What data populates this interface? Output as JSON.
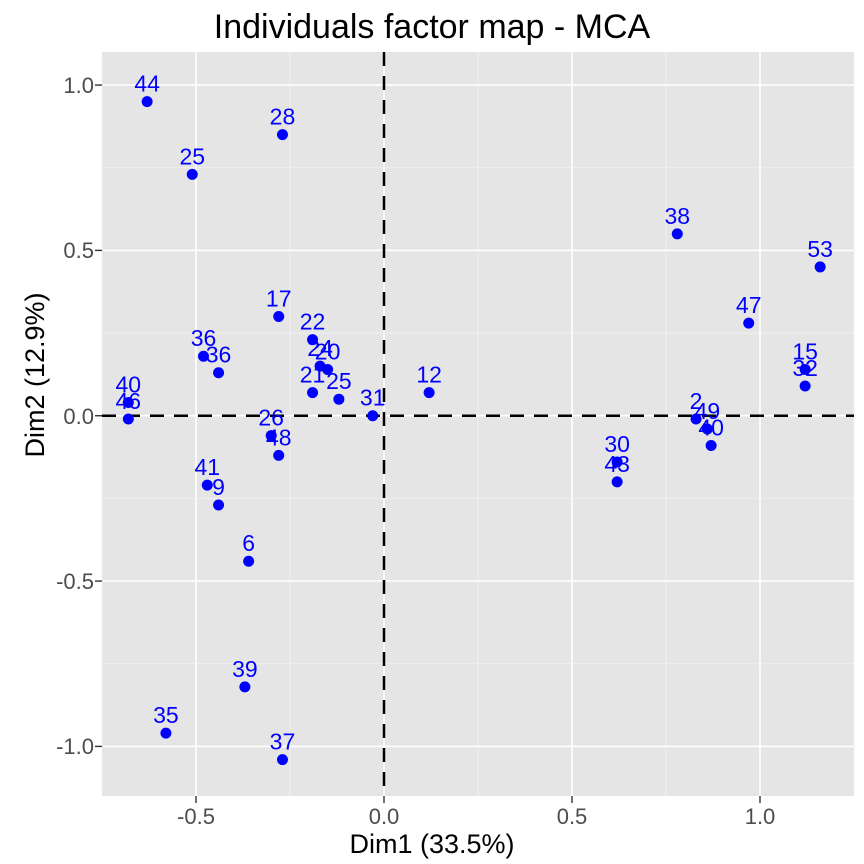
{
  "chart_data": {
    "type": "scatter",
    "title": "Individuals factor map - MCA",
    "xlabel": "Dim1 (33.5%)",
    "ylabel": "Dim2 (12.9%)",
    "xlim": [
      -0.75,
      1.25
    ],
    "ylim": [
      -1.15,
      1.1
    ],
    "x_ticks": [
      -0.5,
      0.0,
      0.5,
      1.0
    ],
    "y_ticks": [
      -1.0,
      -0.5,
      0.0,
      0.5,
      1.0
    ],
    "hline": 0.0,
    "vline": 0.0,
    "point_color": "#0000ff",
    "label_color": "#0000ff",
    "points": [
      {
        "label": "44",
        "x": -0.63,
        "y": 0.95
      },
      {
        "label": "25",
        "x": -0.51,
        "y": 0.73
      },
      {
        "label": "28",
        "x": -0.27,
        "y": 0.85
      },
      {
        "label": "17",
        "x": -0.28,
        "y": 0.3
      },
      {
        "label": "22",
        "x": -0.19,
        "y": 0.23
      },
      {
        "label": "36",
        "x": -0.48,
        "y": 0.18
      },
      {
        "label": "36b",
        "x": -0.44,
        "y": 0.13
      },
      {
        "label": "24",
        "x": -0.17,
        "y": 0.15
      },
      {
        "label": "20",
        "x": -0.15,
        "y": 0.14
      },
      {
        "label": "21",
        "x": -0.19,
        "y": 0.07
      },
      {
        "label": "25b",
        "x": -0.12,
        "y": 0.05
      },
      {
        "label": "31",
        "x": -0.03,
        "y": 0.0
      },
      {
        "label": "12",
        "x": 0.12,
        "y": 0.07
      },
      {
        "label": "40",
        "x": -0.68,
        "y": 0.04
      },
      {
        "label": "46",
        "x": -0.68,
        "y": -0.01
      },
      {
        "label": "26",
        "x": -0.3,
        "y": -0.06
      },
      {
        "label": "48",
        "x": -0.28,
        "y": -0.12
      },
      {
        "label": "41",
        "x": -0.47,
        "y": -0.21
      },
      {
        "label": "9",
        "x": -0.44,
        "y": -0.27
      },
      {
        "label": "6",
        "x": -0.36,
        "y": -0.44
      },
      {
        "label": "39",
        "x": -0.37,
        "y": -0.82
      },
      {
        "label": "35",
        "x": -0.58,
        "y": -0.96
      },
      {
        "label": "37",
        "x": -0.27,
        "y": -1.04
      },
      {
        "label": "38",
        "x": 0.78,
        "y": 0.55
      },
      {
        "label": "53",
        "x": 1.16,
        "y": 0.45
      },
      {
        "label": "47",
        "x": 0.97,
        "y": 0.28
      },
      {
        "label": "15",
        "x": 1.12,
        "y": 0.14
      },
      {
        "label": "32",
        "x": 1.12,
        "y": 0.09
      },
      {
        "label": "2",
        "x": 0.83,
        "y": -0.01
      },
      {
        "label": "49",
        "x": 0.86,
        "y": -0.04
      },
      {
        "label": "40b",
        "x": 0.87,
        "y": -0.09
      },
      {
        "label": "30",
        "x": 0.62,
        "y": -0.14
      },
      {
        "label": "43",
        "x": 0.62,
        "y": -0.2
      }
    ]
  }
}
